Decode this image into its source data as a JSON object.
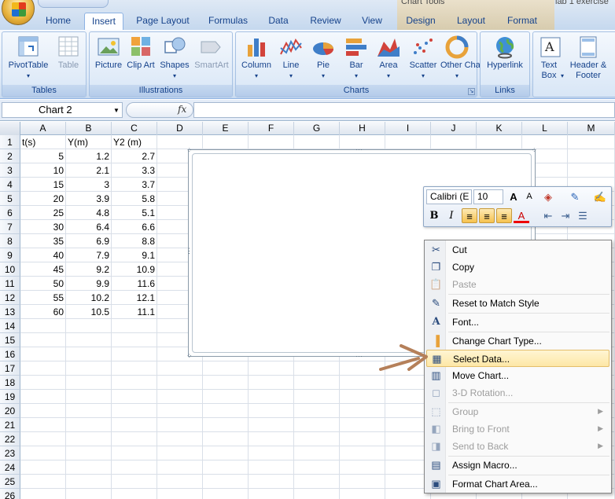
{
  "app": {
    "context_title": "Chart Tools",
    "window_title": "lab 1 exercise"
  },
  "tabs": [
    "Home",
    "Insert",
    "Page Layout",
    "Formulas",
    "Data",
    "Review",
    "View",
    "Design",
    "Layout",
    "Format"
  ],
  "active_tab": "Insert",
  "ribbon": {
    "groups": [
      {
        "label": "Tables",
        "buttons": [
          "PivotTable",
          "Table"
        ]
      },
      {
        "label": "Illustrations",
        "buttons": [
          "Picture",
          "Clip Art",
          "Shapes",
          "SmartArt"
        ]
      },
      {
        "label": "Charts",
        "buttons": [
          "Column",
          "Line",
          "Pie",
          "Bar",
          "Area",
          "Scatter",
          "Other Charts"
        ]
      },
      {
        "label": "Links",
        "buttons": [
          "Hyperlink"
        ]
      },
      {
        "label": "",
        "buttons": [
          "Text Box",
          "Header & Footer"
        ]
      }
    ]
  },
  "formula_bar": {
    "name_box": "Chart 2",
    "fx": "fx",
    "formula": ""
  },
  "columns": [
    "A",
    "B",
    "C",
    "D",
    "E",
    "F",
    "G",
    "H",
    "I",
    "J",
    "K",
    "L",
    "M"
  ],
  "rows": [
    "1",
    "2",
    "3",
    "4",
    "5",
    "6",
    "7",
    "8",
    "9",
    "10",
    "11",
    "12",
    "13",
    "14",
    "15",
    "16",
    "17",
    "18",
    "19",
    "20",
    "21",
    "22",
    "23",
    "24",
    "25",
    "26"
  ],
  "sheet": {
    "headers": [
      "t(s)",
      "Y(m)",
      "Y2 (m)"
    ],
    "data": [
      [
        "5",
        "1.2",
        "2.7"
      ],
      [
        "10",
        "2.1",
        "3.3"
      ],
      [
        "15",
        "3",
        "3.7"
      ],
      [
        "20",
        "3.9",
        "5.8"
      ],
      [
        "25",
        "4.8",
        "5.1"
      ],
      [
        "30",
        "6.4",
        "6.6"
      ],
      [
        "35",
        "6.9",
        "8.8"
      ],
      [
        "40",
        "7.9",
        "9.1"
      ],
      [
        "45",
        "9.2",
        "10.9"
      ],
      [
        "50",
        "9.9",
        "11.6"
      ],
      [
        "55",
        "10.2",
        "12.1"
      ],
      [
        "60",
        "10.5",
        "11.1"
      ]
    ]
  },
  "mini_toolbar": {
    "font": "Calibri (E",
    "size": "10",
    "bold": "B",
    "italic": "I",
    "grow": "A",
    "shrink": "A"
  },
  "context_menu": {
    "items": [
      {
        "label": "Cut",
        "icon": "scissors-icon",
        "enabled": true
      },
      {
        "label": "Copy",
        "icon": "copy-icon",
        "enabled": true
      },
      {
        "label": "Paste",
        "icon": "paste-icon",
        "enabled": false
      },
      {
        "label": "Reset to Match Style",
        "icon": "reset-style-icon",
        "enabled": true
      },
      {
        "label": "Font...",
        "icon": "font-icon",
        "enabled": true
      },
      {
        "label": "Change Chart Type...",
        "icon": "chart-type-icon",
        "enabled": true
      },
      {
        "label": "Select Data...",
        "icon": "select-data-icon",
        "enabled": true,
        "highlighted": true
      },
      {
        "label": "Move Chart...",
        "icon": "move-chart-icon",
        "enabled": true
      },
      {
        "label": "3-D Rotation...",
        "icon": "rotation-icon",
        "enabled": false
      },
      {
        "label": "Group",
        "icon": "group-icon",
        "enabled": false,
        "submenu": true
      },
      {
        "label": "Bring to Front",
        "icon": "bring-front-icon",
        "enabled": false,
        "submenu": true
      },
      {
        "label": "Send to Back",
        "icon": "send-back-icon",
        "enabled": false,
        "submenu": true
      },
      {
        "label": "Assign Macro...",
        "icon": "macro-icon",
        "enabled": true
      },
      {
        "label": "Format Chart Area...",
        "icon": "format-chart-icon",
        "enabled": true
      }
    ]
  },
  "colors": {
    "ribbon_text": "#15428b",
    "highlight": "#fde7a6",
    "arrow": "#b5805a"
  }
}
